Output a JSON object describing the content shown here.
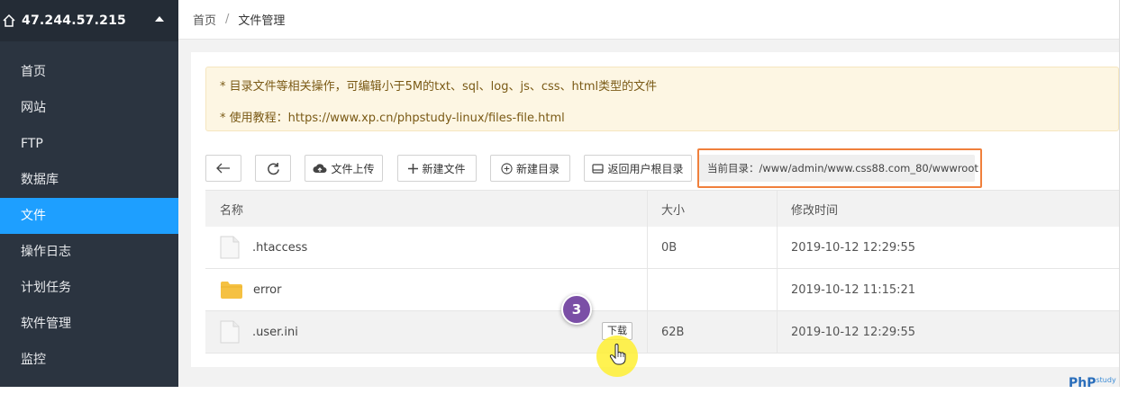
{
  "sidebar": {
    "host": "47.244.57.215",
    "items": [
      {
        "label": "首页"
      },
      {
        "label": "网站"
      },
      {
        "label": "FTP"
      },
      {
        "label": "数据库"
      },
      {
        "label": "文件",
        "active": true
      },
      {
        "label": "操作日志"
      },
      {
        "label": "计划任务"
      },
      {
        "label": "软件管理"
      },
      {
        "label": "监控"
      }
    ]
  },
  "breadcrumb": {
    "home": "首页",
    "sep": "/",
    "current": "文件管理"
  },
  "notice": {
    "line1": "* 目录文件等相关操作，可编辑小于5M的txt、sql、log、js、css、html类型的文件",
    "line2": "* 使用教程：https://www.xp.cn/phpstudy-linux/files-file.html"
  },
  "toolbar": {
    "upload": "文件上传",
    "new_file": "新建文件",
    "new_dir": "新建目录",
    "home_dir": "返回用户根目录",
    "current_path": "当前目录：/www/admin/www.css88.com_80/wwwroot"
  },
  "table": {
    "headers": {
      "name": "名称",
      "size": "大小",
      "mtime": "修改时间"
    },
    "rows": [
      {
        "name": ".htaccess",
        "size": "0B",
        "mtime": "2019-10-12 12:29:55",
        "type": "file"
      },
      {
        "name": "error",
        "size": "",
        "mtime": "2019-10-12 11:15:21",
        "type": "folder"
      },
      {
        "name": ".user.ini",
        "size": "62B",
        "mtime": "2019-10-12 12:29:55",
        "type": "file",
        "action": "下载"
      }
    ]
  },
  "overlay": {
    "step": "3",
    "watermark": "PhP",
    "watermark_sub": "study"
  },
  "colors": {
    "sidebar_bg": "#2b3440",
    "active": "#1e9fff",
    "highlight": "#f0803c",
    "badge": "#7b4fa6"
  }
}
